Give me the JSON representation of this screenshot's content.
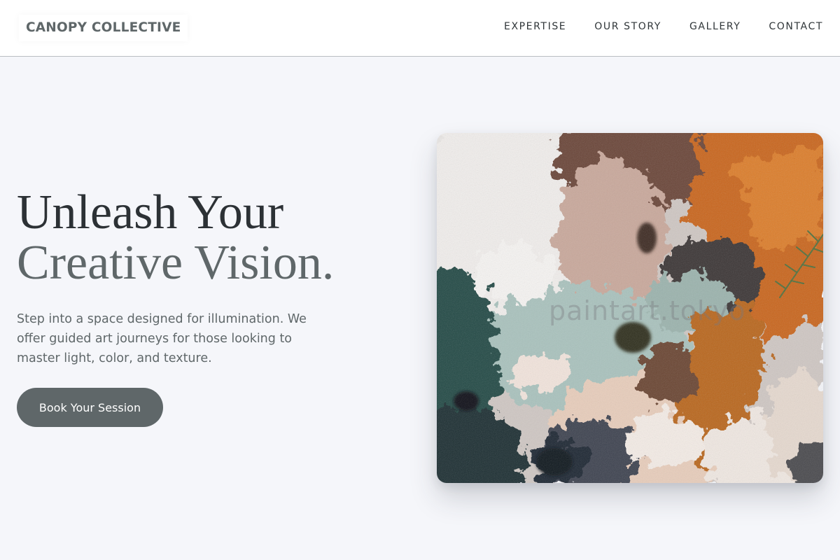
{
  "brand": {
    "name": "CANOPY COLLECTIVE"
  },
  "nav": {
    "items": [
      {
        "label": "EXPERTISE"
      },
      {
        "label": "OUR STORY"
      },
      {
        "label": "GALLERY"
      },
      {
        "label": "CONTACT"
      }
    ]
  },
  "hero": {
    "headline_line1": "Unleash Your",
    "headline_line2": "Creative Vision.",
    "description": "Step into a space designed for illumination. We offer guided art journeys for those looking to master light, color, and texture.",
    "cta_label": "Book Your Session"
  },
  "artwork": {
    "watermark": "paintart.tokyo"
  },
  "colors": {
    "background": "#f5f6fa",
    "brand_text": "#5f6769",
    "headline_dark": "#2c3135",
    "accent": "#5f6769",
    "nav_text": "#2f3538"
  }
}
